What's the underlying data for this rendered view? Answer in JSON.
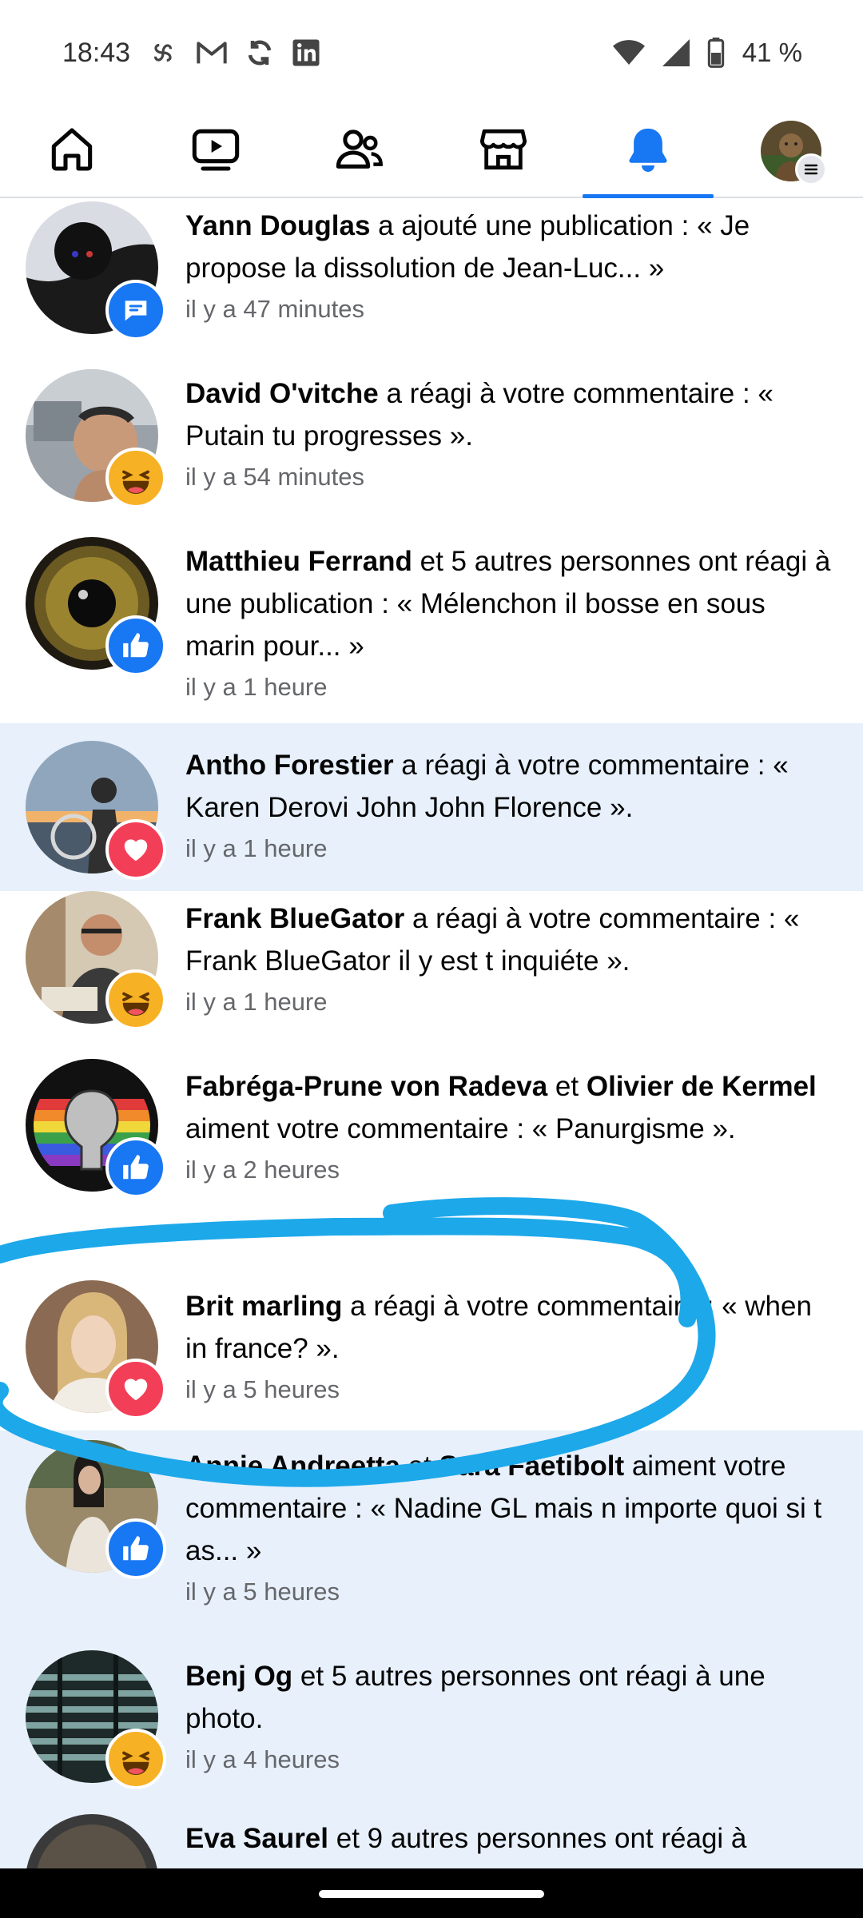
{
  "status_bar": {
    "time": "18:43",
    "notification_icons": [
      "pinwheel-icon",
      "gmail-icon",
      "sync-icon",
      "linkedin-icon"
    ],
    "battery": "41 %"
  },
  "nav": {
    "tabs": [
      {
        "name": "home",
        "icon": "home-icon"
      },
      {
        "name": "video",
        "icon": "video-icon"
      },
      {
        "name": "friends",
        "icon": "friends-icon"
      },
      {
        "name": "marketplace",
        "icon": "marketplace-icon"
      },
      {
        "name": "notifications",
        "icon": "bell-icon",
        "active": true
      },
      {
        "name": "menu",
        "icon": "profile-menu-icon"
      }
    ],
    "accent": "#1877f2"
  },
  "notifications": [
    {
      "actor": "Yann Douglas",
      "text": " a ajouté une publication : « Je propose la dissolution de Jean-Luc... »",
      "time": "il y a 47 minutes",
      "badge": "comment"
    },
    {
      "actor": "David O'vitche",
      "text": " a réagi à votre commentaire : « Putain tu progresses ».",
      "time": "il y a 54 minutes",
      "badge": "haha"
    },
    {
      "actor": "Matthieu Ferrand",
      "text": " et 5 autres personnes ont réagi à une publication : « Mélenchon il bosse en sous marin pour... »",
      "time": "il y a 1 heure",
      "badge": "like"
    },
    {
      "actor": "Antho Forestier",
      "text": " a réagi à votre commentaire : « Karen Derovi John John Florence ».",
      "time": "il y a 1 heure",
      "badge": "love",
      "unread": true
    },
    {
      "actor": "Frank BlueGator",
      "text": " a réagi à votre commentaire : « Frank BlueGator il y est t inquiéte ».",
      "time": "il y a 1 heure",
      "badge": "haha"
    },
    {
      "actor": "Fabréga-Prune von Radeva",
      "connector": " et ",
      "actor2": "Olivier de Kermel",
      "text": " aiment votre commentaire : « Panurgisme ».",
      "time": "il y a 2 heures",
      "badge": "like"
    },
    {
      "actor": "Brit marling",
      "text": " a réagi à votre commentaire : « when in france? ».",
      "time": "il y a 5 heures",
      "badge": "love"
    },
    {
      "actor": "Annie Andreetta",
      "connector": " et ",
      "actor2": "Sara Faetibolt",
      "text": " aiment votre commentaire : « Nadine GL mais n importe quoi si t as... »",
      "time": "il y a 5 heures",
      "badge": "like",
      "unread": true
    },
    {
      "actor": "Benj Og",
      "text": " et 5 autres personnes ont réagi à une photo.",
      "time": "il y a 4 heures",
      "badge": "haha",
      "unread": true
    },
    {
      "actor": "Eva Saurel",
      "text": " et 9 autres personnes ont réagi à",
      "time": "",
      "badge": "like",
      "unread": true
    }
  ],
  "colors": {
    "unread_bg": "#e7f0fb",
    "like": "#1877f2",
    "love": "#f33e58",
    "haha": "#f7b125",
    "annotation": "#1da8ea"
  }
}
